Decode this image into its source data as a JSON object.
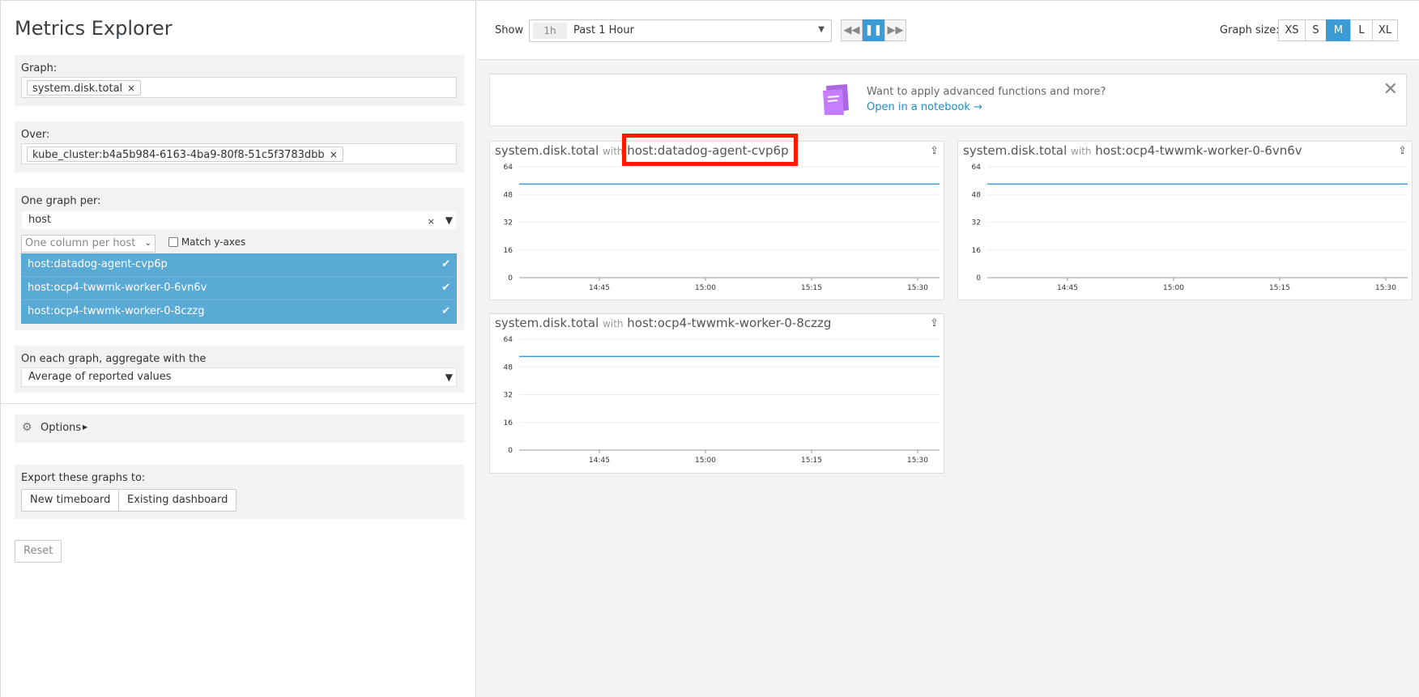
{
  "left": {
    "title": "Metrics Explorer",
    "graph_label": "Graph:",
    "graph_tag": "system.disk.total",
    "over_label": "Over:",
    "over_tag": "kube_cluster:b4a5b984-6163-4ba9-80f8-51c5f3783dbb",
    "one_graph_per_label": "One graph per:",
    "one_graph_per_value": "host",
    "column_select": "One column per host",
    "match_y_axes": "Match y-axes",
    "hosts": [
      "host:datadog-agent-cvp6p",
      "host:ocp4-twwmk-worker-0-6vn6v",
      "host:ocp4-twwmk-worker-0-8czzg"
    ],
    "aggregate_label": "On each graph, aggregate with the",
    "aggregate_value": "Average of reported values",
    "options_label": "Options",
    "export_label": "Export these graphs to:",
    "new_timeboard": "New timeboard",
    "existing_dashboard": "Existing dashboard",
    "reset": "Reset"
  },
  "topbar": {
    "show_label": "Show",
    "time_abbr": "1h",
    "time_value": "Past 1 Hour",
    "graph_size_label": "Graph size:",
    "sizes": [
      "XS",
      "S",
      "M",
      "L",
      "XL"
    ],
    "active_size": "M"
  },
  "banner": {
    "question": "Want to apply advanced functions and more?",
    "link": "Open in a notebook →"
  },
  "graphs": [
    {
      "metric": "system.disk.total",
      "with": "with",
      "host": "host:datadog-agent-cvp6p"
    },
    {
      "metric": "system.disk.total",
      "with": "with",
      "host": "host:ocp4-twwmk-worker-0-6vn6v"
    },
    {
      "metric": "system.disk.total",
      "with": "with",
      "host": "host:ocp4-twwmk-worker-0-8czzg"
    }
  ],
  "chart_data": [
    {
      "type": "line",
      "y_ticks": [
        "64",
        "48",
        "32",
        "16",
        "0"
      ],
      "x_ticks": [
        "14:45",
        "15:00",
        "15:15",
        "15:30"
      ],
      "ylim": [
        0,
        64
      ],
      "series": [
        {
          "values": [
            54,
            54
          ]
        }
      ]
    },
    {
      "type": "line",
      "y_ticks": [
        "64",
        "48",
        "32",
        "16",
        "0"
      ],
      "x_ticks": [
        "14:45",
        "15:00",
        "15:15",
        "15:30"
      ],
      "ylim": [
        0,
        64
      ],
      "series": [
        {
          "values": [
            54,
            54
          ]
        }
      ]
    },
    {
      "type": "line",
      "y_ticks": [
        "64",
        "48",
        "32",
        "16",
        "0"
      ],
      "x_ticks": [
        "14:45",
        "15:00",
        "15:15",
        "15:30"
      ],
      "ylim": [
        0,
        64
      ],
      "series": [
        {
          "values": [
            54,
            54
          ]
        }
      ]
    }
  ],
  "colors": {
    "accent": "#3a9bd5",
    "highlight": "#ff1a00",
    "line": "#3a9bd5"
  }
}
